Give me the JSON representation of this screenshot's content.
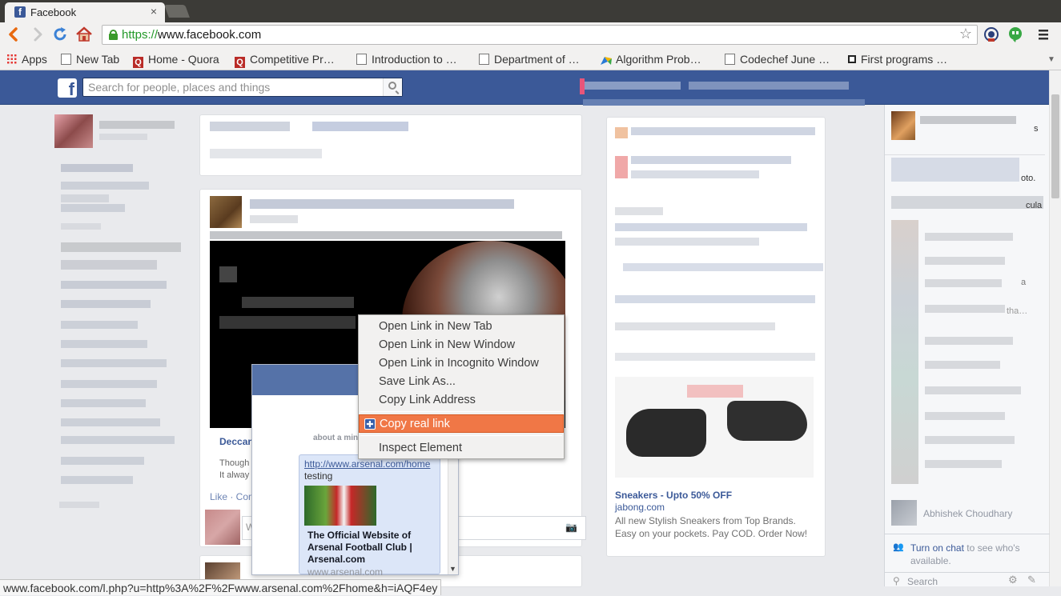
{
  "browser": {
    "tab_title": "Facebook",
    "tab_close": "×",
    "address_scheme": "https://",
    "address_rest": "www.facebook.com",
    "bookmarks": [
      {
        "label": "Apps",
        "icon": "apps-grid-icon"
      },
      {
        "label": "New Tab",
        "icon": "page-icon"
      },
      {
        "label": "Home - Quora",
        "icon": "quora-icon"
      },
      {
        "label": "Competitive Pr…",
        "icon": "quora-icon"
      },
      {
        "label": "Introduction to …",
        "icon": "page-icon"
      },
      {
        "label": "Department of …",
        "icon": "page-icon"
      },
      {
        "label": "Algorithm Prob…",
        "icon": "colorful-spark-icon"
      },
      {
        "label": "Codechef June …",
        "icon": "page-icon"
      },
      {
        "label": "First programs …",
        "icon": "box-icon"
      }
    ],
    "status_url": "www.facebook.com/l.php?u=http%3A%2F%2Fwww.arsenal.com%2Fhome&h=iAQF4ey"
  },
  "facebook": {
    "logo": "f",
    "search_placeholder": "Search for people, places and things",
    "ad": {
      "title": "Sneakers - Upto 50% OFF",
      "domain": "jabong.com",
      "body": "All new Stylish Sneakers from Top Brands. Easy on your pockets. Pay COD. Order Now!"
    },
    "post_fragments": {
      "link_title_partial": "Deccan",
      "text_partial_1": "Though",
      "text_partial_2": "It alway",
      "actions_partial": "Like · Com",
      "comment_placeholder_partial": "W",
      "timestamp_partial": "about a min"
    },
    "chat": {
      "friend_name": "Abhishek Choudhary",
      "turn_on_link": "Turn on chat",
      "turn_on_rest": " to see who's available.",
      "search_placeholder": "Search",
      "cut_texts": [
        "s",
        "oto.",
        "cula",
        "a",
        "tha…"
      ]
    },
    "preview_popup": {
      "link": "http://www.arsenal.com/home",
      "description": "testing",
      "title": "The Official Website of Arsenal Football Club | Arsenal.com",
      "domain": "www.arsenal.com"
    }
  },
  "context_menu": {
    "items": [
      {
        "label": "Open Link in New Tab"
      },
      {
        "label": "Open Link in New Window"
      },
      {
        "label": "Open Link in Incognito Window"
      },
      {
        "label": "Save Link As..."
      },
      {
        "label": "Copy Link Address"
      },
      {
        "label": "Copy real link",
        "highlighted": true,
        "icon": "extension-puzzle-icon"
      },
      {
        "label": "Inspect Element"
      }
    ]
  },
  "colors": {
    "facebook_blue": "#3b5998",
    "menu_highlight": "#f07746",
    "secure_green": "#229928"
  }
}
